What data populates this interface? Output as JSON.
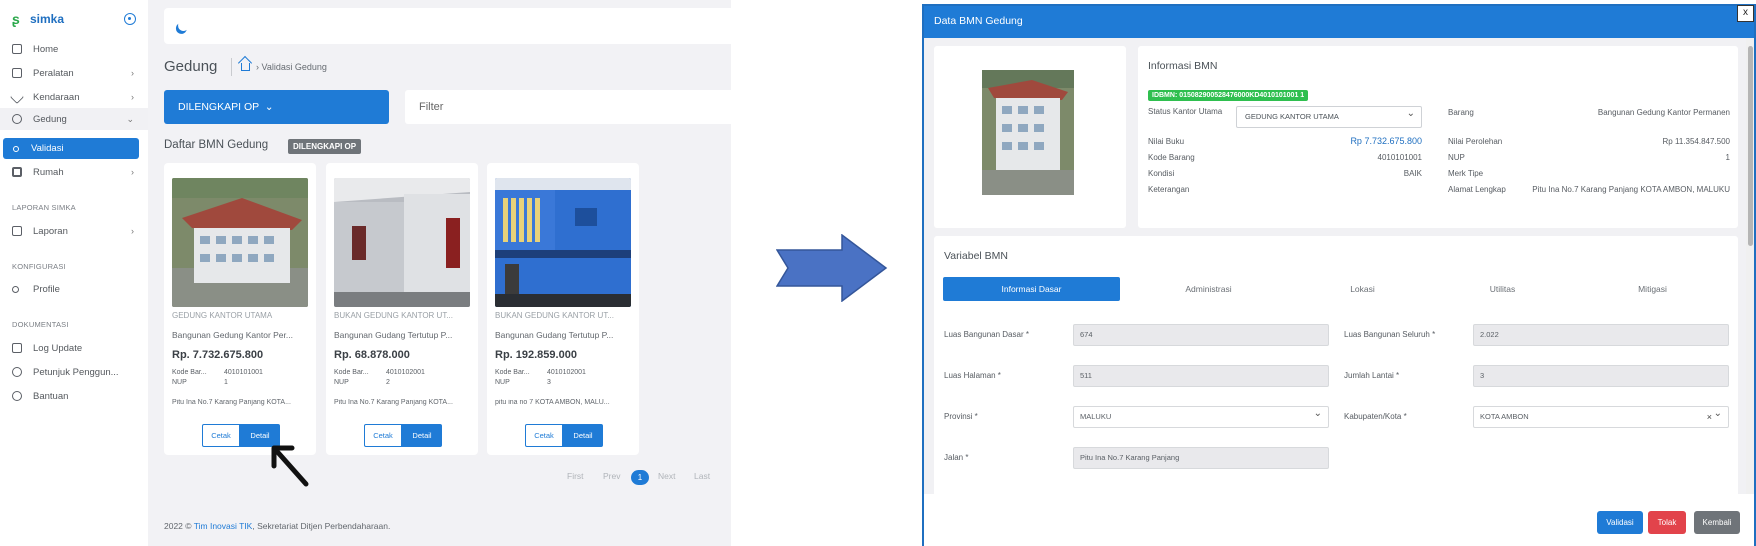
{
  "left_app": {
    "brand": {
      "name": "simka",
      "logo_icon": "simka-logo-icon",
      "toggle_icon": "target-circle-icon"
    },
    "nav": {
      "home": "Home",
      "peralatan": "Peralatan",
      "kendaraan": "Kendaraan",
      "gedung": "Gedung",
      "validasi": "Validasi",
      "rumah": "Rumah",
      "section_laporan": "LAPORAN SIMKA",
      "laporan": "Laporan",
      "section_konfigurasi": "KONFIGURASI",
      "profile": "Profile",
      "section_dokumentasi": "DOKUMENTASI",
      "log_update": "Log Update",
      "petunjuk": "Petunjuk Penggun...",
      "bantuan": "Bantuan"
    },
    "page_title": "Gedung",
    "breadcrumb": "Validasi Gedung",
    "dropdown_label": "DILENGKAPI OP",
    "filter_placeholder": "Filter",
    "list_title": "Daftar BMN Gedung",
    "list_badge": "DILENGKAPI OP",
    "cards": [
      {
        "status": "GEDUNG KANTOR UTAMA",
        "name": "Bangunan Gedung Kantor Per...",
        "price": "Rp. 7.732.675.800",
        "kode_label": "Kode Bar...",
        "kode_value": "4010101001",
        "nup_label": "NUP",
        "nup_value": "1",
        "address": "Pitu Ina No.7 Karang Panjang KOTA...",
        "btn_cetak": "Cetak",
        "btn_detail": "Detail"
      },
      {
        "status": "BUKAN GEDUNG KANTOR UT...",
        "name": "Bangunan Gudang Tertutup P...",
        "price": "Rp. 68.878.000",
        "kode_label": "Kode Bar...",
        "kode_value": "4010102001",
        "nup_label": "NUP",
        "nup_value": "2",
        "address": "Pitu Ina No.7 Karang Panjang KOTA...",
        "btn_cetak": "Cetak",
        "btn_detail": "Detail"
      },
      {
        "status": "BUKAN GEDUNG KANTOR UT...",
        "name": "Bangunan Gudang Tertutup P...",
        "price": "Rp. 192.859.000",
        "kode_label": "Kode Bar...",
        "kode_value": "4010102001",
        "nup_label": "NUP",
        "nup_value": "3",
        "address": "pitu ina no 7 KOTA AMBON, MALU...",
        "btn_cetak": "Cetak",
        "btn_detail": "Detail"
      }
    ],
    "pager": {
      "first": "First",
      "prev": "Prev",
      "current": "1",
      "next": "Next",
      "last": "Last"
    },
    "footer": {
      "prefix": "2022 ©",
      "link": "Tim Inovasi TIK",
      "suffix": ", Sekretariat Ditjen Perbendaharaan."
    }
  },
  "modal": {
    "title": "Data BMN Gedung",
    "close": "x",
    "info": {
      "title": "Informasi BMN",
      "idbmn": "IDBMN: 015082900528476000KD4010101001 1",
      "status_label": "Status Kantor Utama",
      "status_value": "GEDUNG KANTOR UTAMA",
      "barang_label": "Barang",
      "barang_value": "Bangunan Gedung Kantor Permanen",
      "nilai_buku_label": "Nilai Buku",
      "nilai_buku_value": "Rp 7.732.675.800",
      "nilai_perolehan_label": "Nilai Perolehan",
      "nilai_perolehan_value": "Rp 11.354.847.500",
      "kode_label": "Kode Barang",
      "kode_value": "4010101001",
      "nup_label": "NUP",
      "nup_value": "1",
      "kondisi_label": "Kondisi",
      "kondisi_value": "BAIK",
      "merk_label": "Merk Tipe",
      "merk_value": "",
      "keterangan_label": "Keterangan",
      "keterangan_value": "",
      "alamat_label": "Alamat Lengkap",
      "alamat_value": "Pitu Ina No.7 Karang Panjang KOTA AMBON, MALUKU"
    },
    "variabel": {
      "title": "Variabel BMN",
      "tabs": [
        "Informasi Dasar",
        "Administrasi",
        "Lokasi",
        "Utilitas",
        "Mitigasi"
      ],
      "fields": {
        "luas_dasar_label": "Luas Bangunan Dasar *",
        "luas_dasar_value": "674",
        "luas_seluruh_label": "Luas Bangunan Seluruh *",
        "luas_seluruh_value": "2.022",
        "luas_halaman_label": "Luas Halaman *",
        "luas_halaman_value": "511",
        "jumlah_lantai_label": "Jumlah Lantai *",
        "jumlah_lantai_value": "3",
        "provinsi_label": "Provinsi *",
        "provinsi_value": "MALUKU",
        "kabupaten_label": "Kabupaten/Kota *",
        "kabupaten_value": "KOTA AMBON",
        "kabupaten_clear": "×",
        "jalan_label": "Jalan *",
        "jalan_value": "Pitu Ina No.7 Karang Panjang"
      }
    },
    "buttons": {
      "validasi": "Validasi",
      "tolak": "Tolak",
      "kembali": "Kembali"
    }
  },
  "colors": {
    "primary": "#1f7bd6",
    "success": "#2fbf4f",
    "danger": "#e2434b",
    "secondary": "#6f7479",
    "arrow": "#4a72c4"
  }
}
